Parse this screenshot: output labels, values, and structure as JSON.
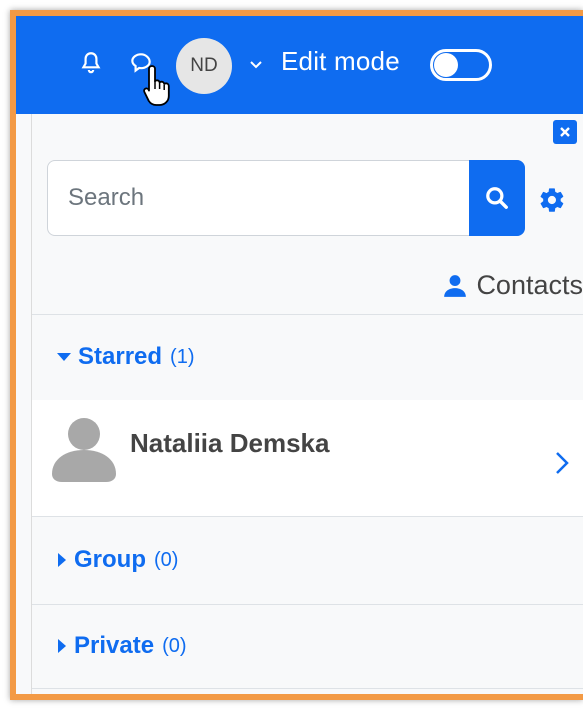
{
  "topbar": {
    "avatar_initials": "ND",
    "edit_mode_label": "Edit mode",
    "edit_mode_on": false,
    "accent_color": "#0f6cf0"
  },
  "drawer": {
    "close_icon": "close-icon",
    "search": {
      "placeholder": "Search",
      "value": ""
    },
    "contacts_label": "Contacts",
    "sections": {
      "starred": {
        "label": "Starred",
        "count": "(1)",
        "expanded": true
      },
      "group": {
        "label": "Group",
        "count": "(0)",
        "expanded": false
      },
      "private": {
        "label": "Private",
        "count": "(0)",
        "expanded": false
      }
    },
    "starred_items": [
      {
        "name": "Nataliia Demska"
      }
    ]
  },
  "frame_color": "#f39a45"
}
